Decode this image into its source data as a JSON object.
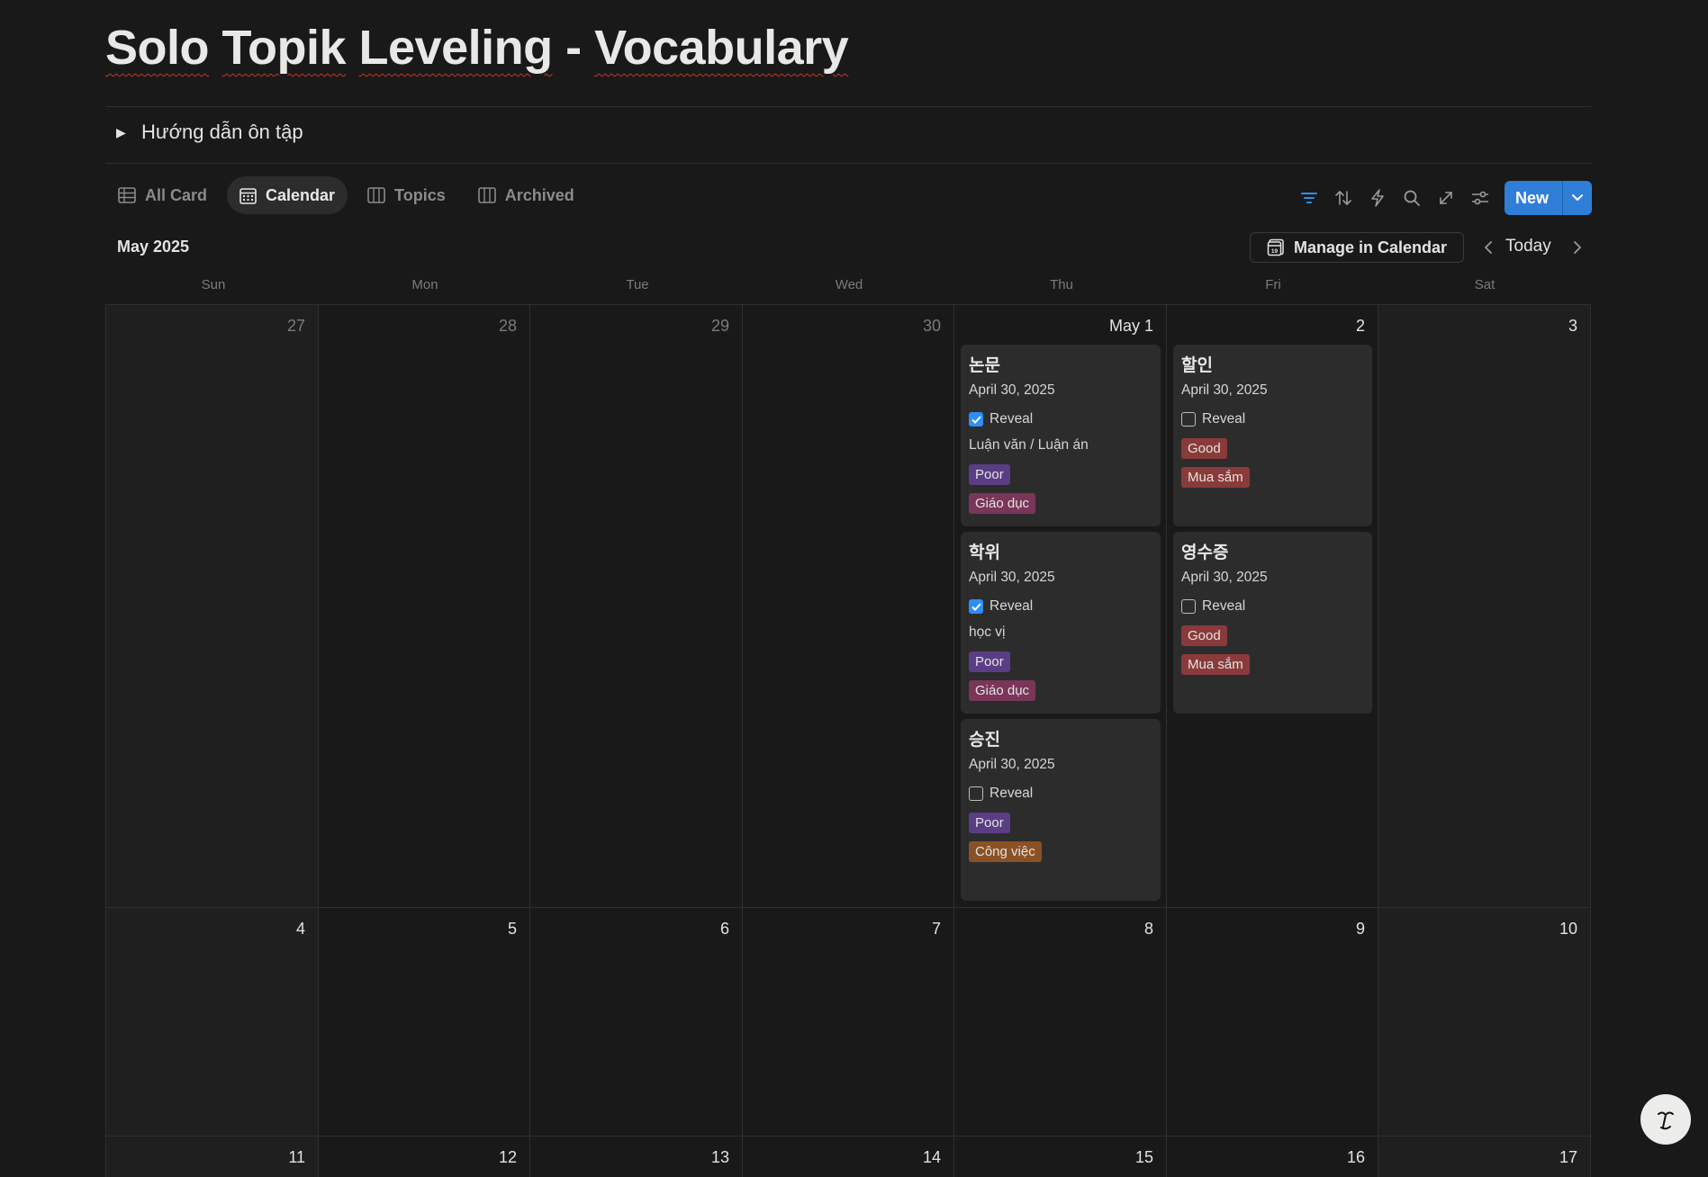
{
  "page": {
    "title_part1": "Solo",
    "title_part2": "Topik",
    "title_part3": "Leveling",
    "title_sep": "-",
    "title_part4": "Vocabulary",
    "toggle_label": "Hướng dẫn ôn tập"
  },
  "tabs": [
    {
      "label": "All Card",
      "icon": "table-icon"
    },
    {
      "label": "Calendar",
      "icon": "calendar-icon",
      "active": true
    },
    {
      "label": "Topics",
      "icon": "board-icon"
    },
    {
      "label": "Archived",
      "icon": "board-icon"
    }
  ],
  "toolbar": {
    "icons": [
      "filter-icon",
      "sort-icon",
      "lightning-icon",
      "search-icon",
      "expand-icon",
      "settings-icon"
    ],
    "new_label": "New",
    "accent": "#2f7fd8"
  },
  "calendar": {
    "month_label": "May 2025",
    "manage_label": "Manage in Calendar",
    "today_label": "Today",
    "weekdays": [
      "Sun",
      "Mon",
      "Tue",
      "Wed",
      "Thu",
      "Fri",
      "Sat"
    ],
    "weeks": [
      [
        "27",
        "28",
        "29",
        "30",
        "May 1",
        "2",
        "3"
      ],
      [
        "4",
        "5",
        "6",
        "7",
        "8",
        "9",
        "10"
      ],
      [
        "11",
        "12",
        "13",
        "14",
        "15",
        "16",
        "17"
      ]
    ]
  },
  "cards": {
    "thu": [
      {
        "word": "논문",
        "date": "April 30, 2025",
        "reveal_label": "Reveal",
        "revealed": true,
        "meaning": "Luận văn / Luận án",
        "rating": "Poor",
        "topic": "Giáo dục"
      },
      {
        "word": "학위",
        "date": "April 30, 2025",
        "reveal_label": "Reveal",
        "revealed": true,
        "meaning": "học vị",
        "rating": "Poor",
        "topic": "Giáo dục"
      },
      {
        "word": "승진",
        "date": "April 30, 2025",
        "reveal_label": "Reveal",
        "revealed": false,
        "meaning": "",
        "rating": "Poor",
        "topic": "Công việc"
      }
    ],
    "fri": [
      {
        "word": "할인",
        "date": "April 30, 2025",
        "reveal_label": "Reveal",
        "revealed": false,
        "meaning": "",
        "rating": "Good",
        "topic": "Mua sắm"
      },
      {
        "word": "영수증",
        "date": "April 30, 2025",
        "reveal_label": "Reveal",
        "revealed": false,
        "meaning": "",
        "rating": "Good",
        "topic": "Mua sắm"
      }
    ]
  },
  "tag_colors": {
    "Poor": "#5a3d85",
    "Good": "#8a3a3a",
    "Giáo dục": "#7a3559",
    "Mua sắm": "#8a3a3a",
    "Công việc": "#8a5224"
  }
}
